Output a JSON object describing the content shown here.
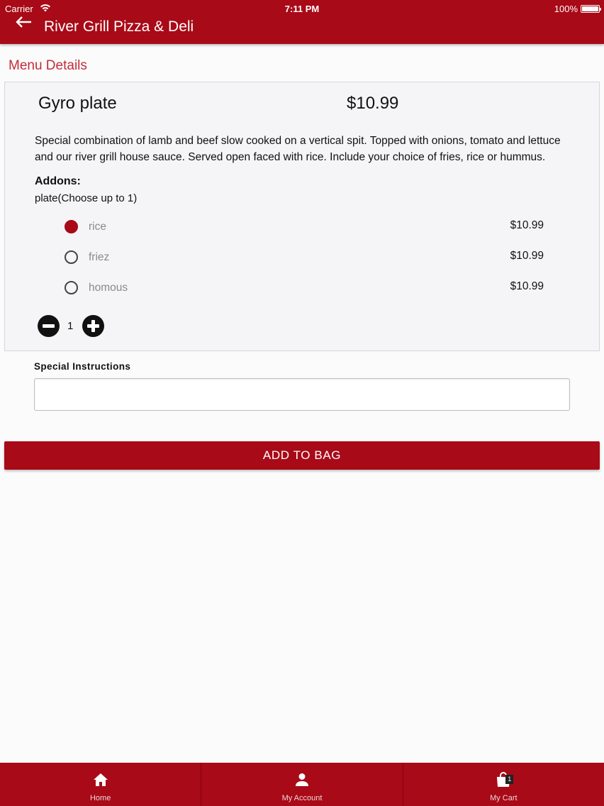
{
  "status_bar": {
    "carrier": "Carrier",
    "time": "7:11 PM",
    "battery": "100%"
  },
  "header": {
    "title": "River Grill Pizza & Deli",
    "back_icon": "arrow-left-icon"
  },
  "section_title": "Menu Details",
  "item": {
    "name": "Gyro plate",
    "price": "$10.99",
    "description": "Special combination of lamb and beef slow cooked on a vertical spit. Topped with onions, tomato and lettuce and our river grill house sauce. Served open faced with rice. Include your choice of fries, rice or hummus."
  },
  "addons": {
    "label": "Addons:",
    "group": "plate(Choose up to 1)",
    "options": [
      {
        "label": "rice",
        "price": "$10.99",
        "selected": true
      },
      {
        "label": "friez",
        "price": "$10.99",
        "selected": false
      },
      {
        "label": "homous",
        "price": "$10.99",
        "selected": false
      }
    ]
  },
  "quantity": {
    "value": "1"
  },
  "special_instructions": {
    "label": "Special Instructions",
    "value": "",
    "placeholder": ""
  },
  "add_to_bag_label": "ADD TO BAG",
  "tabs": [
    {
      "label": "Home",
      "icon": "home-icon"
    },
    {
      "label": "My Account",
      "icon": "person-icon"
    },
    {
      "label": "My Cart",
      "icon": "shopping-bag-icon",
      "badge": "1"
    }
  ],
  "colors": {
    "primary": "#a80a17",
    "section_title": "#c42c3a",
    "card_bg": "#f5f5f7"
  }
}
